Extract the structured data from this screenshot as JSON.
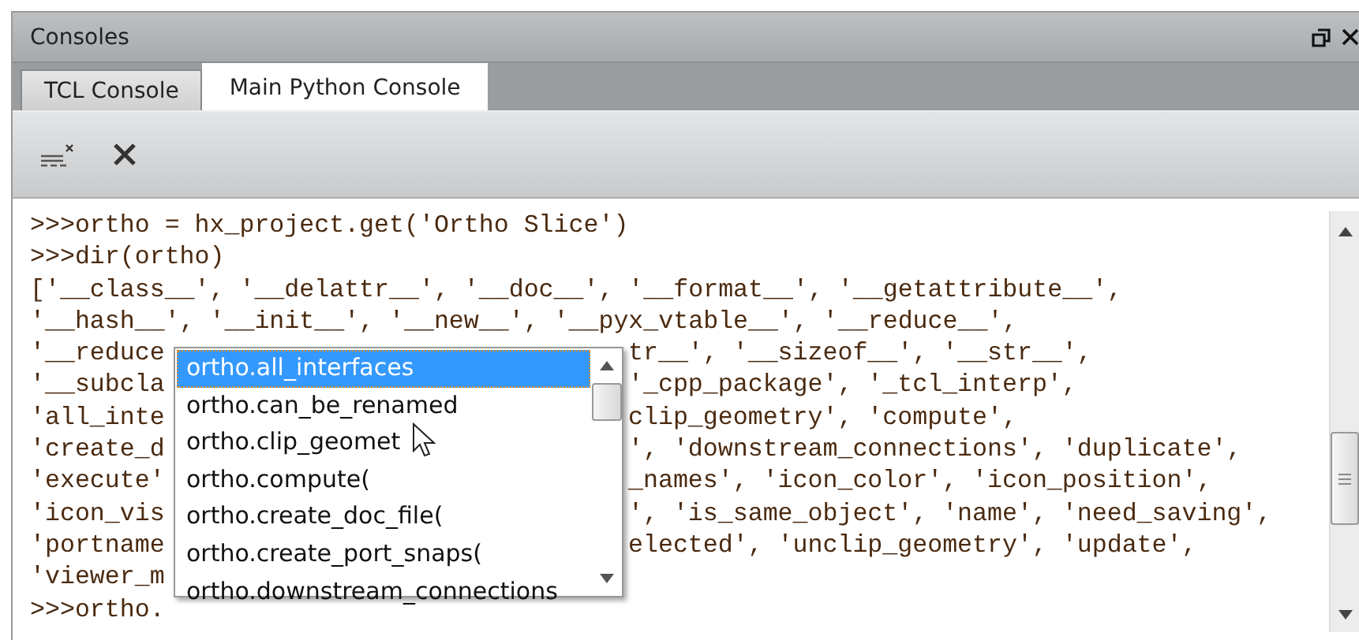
{
  "panel": {
    "title": "Consoles"
  },
  "tabs": [
    {
      "label": "TCL Console",
      "selected": false
    },
    {
      "label": "Main Python Console",
      "selected": true
    }
  ],
  "console": {
    "lines": [
      {
        "left": ">>>ortho = hx_project.get('Ortho Slice')"
      },
      {
        "left": ">>>dir(ortho)"
      },
      {
        "left": "['__class__', '__delattr__', '__doc__', '__format__', '__getattribute__',"
      },
      {
        "left": "'__hash__', '__init__', '__new__', '__pyx_vtable__', '__reduce__',"
      },
      {
        "left": "'__reduce",
        "right": "tr__', '__sizeof__', '__str__',"
      },
      {
        "left": "'__subcla",
        "right": "'_cpp_package', '_tcl_interp',"
      },
      {
        "left": "'all_inte",
        "right": "clip_geometry', 'compute',"
      },
      {
        "left": "'create_d",
        "right": "', 'downstream_connections', 'duplicate',"
      },
      {
        "left": "'execute'",
        "right": "_names', 'icon_color', 'icon_position',"
      },
      {
        "left": "'icon_vis",
        "right": "', 'is_same_object', 'name', 'need_saving',"
      },
      {
        "left": "'portname",
        "right": "elected', 'unclip_geometry', 'update',"
      },
      {
        "left": "'viewer_m"
      },
      {
        "left": ">>>ortho."
      }
    ]
  },
  "autocomplete": {
    "items": [
      {
        "label": "ortho.all_interfaces",
        "selected": true
      },
      {
        "label": "ortho.can_be_renamed",
        "selected": false
      },
      {
        "label": "ortho.clip_geomet",
        "selected": false
      },
      {
        "label": "ortho.compute(",
        "selected": false
      },
      {
        "label": "ortho.create_doc_file(",
        "selected": false
      },
      {
        "label": "ortho.create_port_snaps(",
        "selected": false
      },
      {
        "label": "ortho.downstream_connections",
        "selected": false
      }
    ]
  }
}
